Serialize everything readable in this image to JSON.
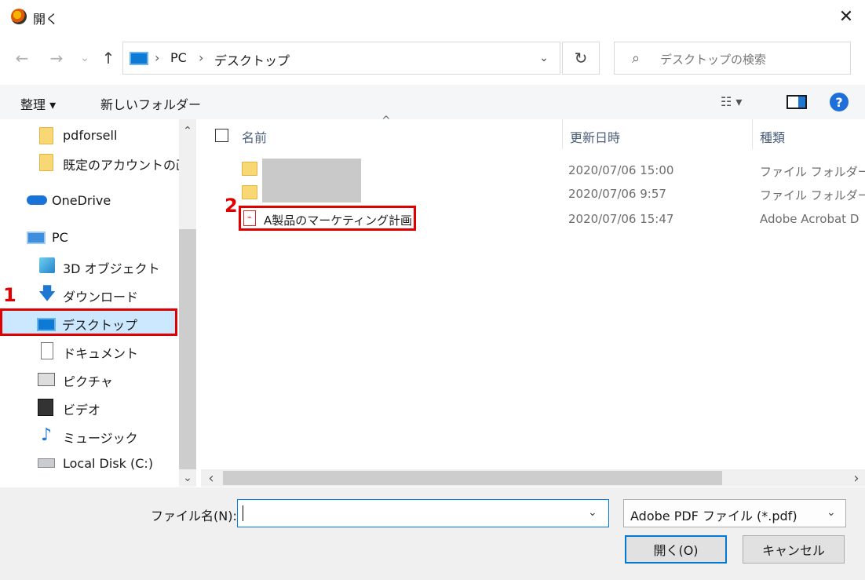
{
  "window": {
    "title": "開く",
    "close_glyph": "✕"
  },
  "nav": {
    "back_glyph": "←",
    "forward_glyph": "→",
    "recent_glyph": "⌄",
    "up_glyph": "↑",
    "breadcrumb": [
      "PC",
      "デスクトップ"
    ],
    "separator": "›",
    "refresh_glyph": "↻",
    "search_placeholder": "デスクトップの検索"
  },
  "toolbar": {
    "organize_label": "整理 ▾",
    "new_folder_label": "新しいフォルダー",
    "view_glyph": "☷ ▾",
    "help_glyph": "?"
  },
  "sidebar": {
    "items": [
      {
        "label": "pdforsell",
        "icon": "folder-icon"
      },
      {
        "label": "既定のアカウントの画",
        "icon": "folder-icon"
      },
      {
        "label": "OneDrive",
        "icon": "onedrive-icon"
      },
      {
        "label": "PC",
        "icon": "pc-icon"
      },
      {
        "label": "3D オブジェクト",
        "icon": "3d-objects-icon"
      },
      {
        "label": "ダウンロード",
        "icon": "download-icon"
      },
      {
        "label": "デスクトップ",
        "icon": "desktop-icon"
      },
      {
        "label": "ドキュメント",
        "icon": "documents-icon"
      },
      {
        "label": "ピクチャ",
        "icon": "pictures-icon"
      },
      {
        "label": "ビデオ",
        "icon": "videos-icon"
      },
      {
        "label": "ミュージック",
        "icon": "music-icon"
      },
      {
        "label": "Local Disk (C:)",
        "icon": "disk-icon"
      }
    ],
    "scroll_up": "⌃",
    "scroll_down": "⌄"
  },
  "filelist": {
    "columns": {
      "name": "名前",
      "date": "更新日時",
      "type": "種類"
    },
    "sort_glyph": "^",
    "rows": [
      {
        "name": "",
        "date": "2020/07/06 15:00",
        "type": "ファイル フォルダー"
      },
      {
        "name": "",
        "date": "2020/07/06 9:57",
        "type": "ファイル フォルダー"
      },
      {
        "name": "A製品のマーケティング計画",
        "date": "2020/07/06 15:47",
        "type": "Adobe Acrobat D"
      }
    ],
    "hscroll_left": "‹",
    "hscroll_right": "›"
  },
  "annotations": {
    "step1": "1",
    "step2": "2"
  },
  "footer": {
    "filename_label": "ファイル名(N):",
    "filename_value": "",
    "filter_value": "Adobe PDF ファイル (*.pdf)",
    "dropdown_glyph": "⌄",
    "open_label": "開く(O)",
    "cancel_label": "キャンセル"
  }
}
